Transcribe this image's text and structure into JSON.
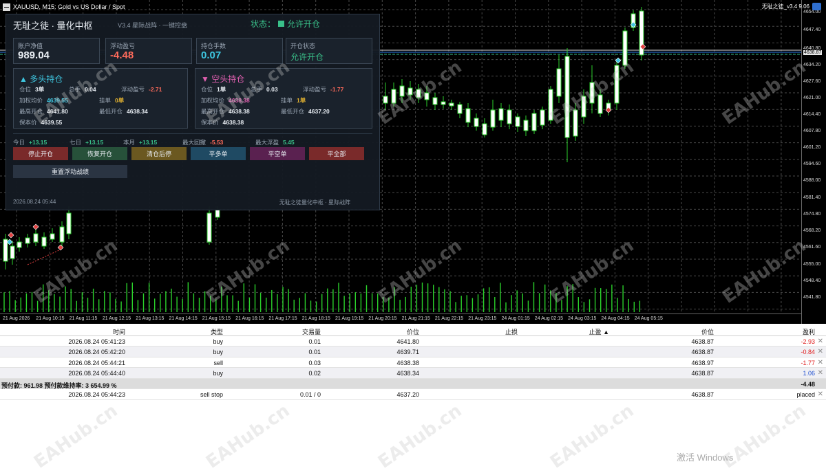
{
  "chart": {
    "title": "XAUUSD, M15:  Gold vs US Dollar / Spot",
    "ea_label": "无耻之徒_v3.4 9.06",
    "price_labels": [
      "4654.00",
      "4647.40",
      "4640.80",
      "4638.87",
      "4634.20",
      "4627.60",
      "4621.00",
      "4614.40",
      "4607.80",
      "4601.20",
      "4594.60",
      "4588.00",
      "4581.40",
      "4574.80",
      "4568.20",
      "4561.60",
      "4555.00",
      "4548.40",
      "4541.80"
    ],
    "time_labels": [
      "21 Aug 2026",
      "21 Aug 10:15",
      "21 Aug 11:15",
      "21 Aug 12:15",
      "21 Aug 13:15",
      "21 Aug 14:15",
      "21 Aug 15:15",
      "21 Aug 16:15",
      "21 Aug 17:15",
      "21 Aug 18:15",
      "21 Aug 19:15",
      "21 Aug 20:15",
      "21 Aug 21:15",
      "21 Aug 22:15",
      "21 Aug 23:15",
      "24 Aug 01:15",
      "24 Aug 02:15",
      "24 Aug 03:15",
      "24 Aug 04:15",
      "24 Aug 05:15"
    ],
    "current_price": "4638.87"
  },
  "panel": {
    "title": "无耻之徒 · 量化中枢",
    "version": "V3.4  星际战阵 · 一键控盘",
    "status_label": "状态：",
    "status_value": "允许开仓",
    "cards": [
      {
        "label": "账户净值",
        "value": "989.04",
        "color": "#e8edf3"
      },
      {
        "label": "浮动盈亏",
        "value": "-4.48",
        "color": "#ff6b5b"
      },
      {
        "label": "持仓手数",
        "value": "0.07",
        "color": "#3ec6e0"
      },
      {
        "label": "开仓状态",
        "value": "允许开仓",
        "color": "#39c089"
      }
    ],
    "long": {
      "title": "▲ 多头持仓",
      "pos_l": "仓位",
      "pos_v": "3单",
      "lots_l": "总手",
      "lots_v": "0.04",
      "pnl_l": "浮动盈亏",
      "pnl_v": "-2.71",
      "avg_l": "加权均价",
      "avg_v": "4639.55",
      "pend_l": "挂单",
      "pend_v": "0单",
      "hi_l": "最高开仓",
      "hi_v": "4641.80",
      "lo_l": "最低开仓",
      "lo_v": "4638.34",
      "be_l": "保本价",
      "be_v": "4639.55"
    },
    "short": {
      "title": "▼ 空头持仓",
      "pos_l": "仓位",
      "pos_v": "1单",
      "lots_l": "总手",
      "lots_v": "0.03",
      "pnl_l": "浮动盈亏",
      "pnl_v": "-1.77",
      "avg_l": "加权均价",
      "avg_v": "4638.38",
      "pend_l": "挂单",
      "pend_v": "1单",
      "hi_l": "最高开仓",
      "hi_v": "4638.38",
      "lo_l": "最低开仓",
      "lo_v": "4637.20",
      "be_l": "保本价",
      "be_v": "4638.38"
    },
    "stats": [
      {
        "label": "今日",
        "value": "+13.15",
        "color": "#39c089"
      },
      {
        "label": "七日",
        "value": "+13.15",
        "color": "#39c089"
      },
      {
        "label": "本月",
        "value": "+13.15",
        "color": "#39c089"
      },
      {
        "label": "最大回撤",
        "value": "-5.53",
        "color": "#ff6b5b"
      },
      {
        "label": "最大浮盈",
        "value": "5.45",
        "color": "#39c089"
      }
    ],
    "buttons": [
      {
        "label": "停止开仓",
        "bg": "#7a2a2a"
      },
      {
        "label": "恢复开仓",
        "bg": "#27513a"
      },
      {
        "label": "清仓后停",
        "bg": "#6b5820"
      },
      {
        "label": "平多单",
        "bg": "#1f4a63"
      },
      {
        "label": "平空单",
        "bg": "#5a2150"
      },
      {
        "label": "平全部",
        "bg": "#7a2a2a"
      }
    ],
    "reset_button": "重置浮动战绩",
    "timestamp": "2026.08.24 05:44",
    "footer": "无耻之徒量化中枢 · 星际战阵"
  },
  "table": {
    "headers": {
      "time": "时间",
      "type": "类型",
      "volume": "交易量",
      "price": "价位",
      "sl": "止损",
      "tp": "止盈",
      "cur": "价位",
      "profit": "盈利"
    },
    "rows": [
      {
        "time": "2026.08.24 05:41:23",
        "type": "buy",
        "volume": "0.01",
        "price": "4641.80",
        "cur": "4638.87",
        "profit": "-2.93",
        "pc": "#e02020"
      },
      {
        "time": "2026.08.24 05:42:20",
        "type": "buy",
        "volume": "0.01",
        "price": "4639.71",
        "cur": "4638.87",
        "profit": "-0.84",
        "pc": "#e02020"
      },
      {
        "time": "2026.08.24 05:44:21",
        "type": "sell",
        "volume": "0.03",
        "price": "4638.38",
        "cur": "4638.97",
        "profit": "-1.77",
        "pc": "#e02020"
      },
      {
        "time": "2026.08.24 05:44:40",
        "type": "buy",
        "volume": "0.02",
        "price": "4638.34",
        "cur": "4638.87",
        "profit": "1.06",
        "pc": "#1f4fd0"
      }
    ],
    "summary": {
      "text": "预付款: 961.98  预付款维持率: 3 654.99 %",
      "profit": "-4.48"
    },
    "pending": {
      "time": "2026.08.24 05:44:23",
      "type": "sell stop",
      "volume": "0.01 / 0",
      "price": "4637.20",
      "cur": "4638.87",
      "profit": "placed"
    }
  },
  "watermark": "EAHub.cn",
  "activate": "激活 Windows"
}
